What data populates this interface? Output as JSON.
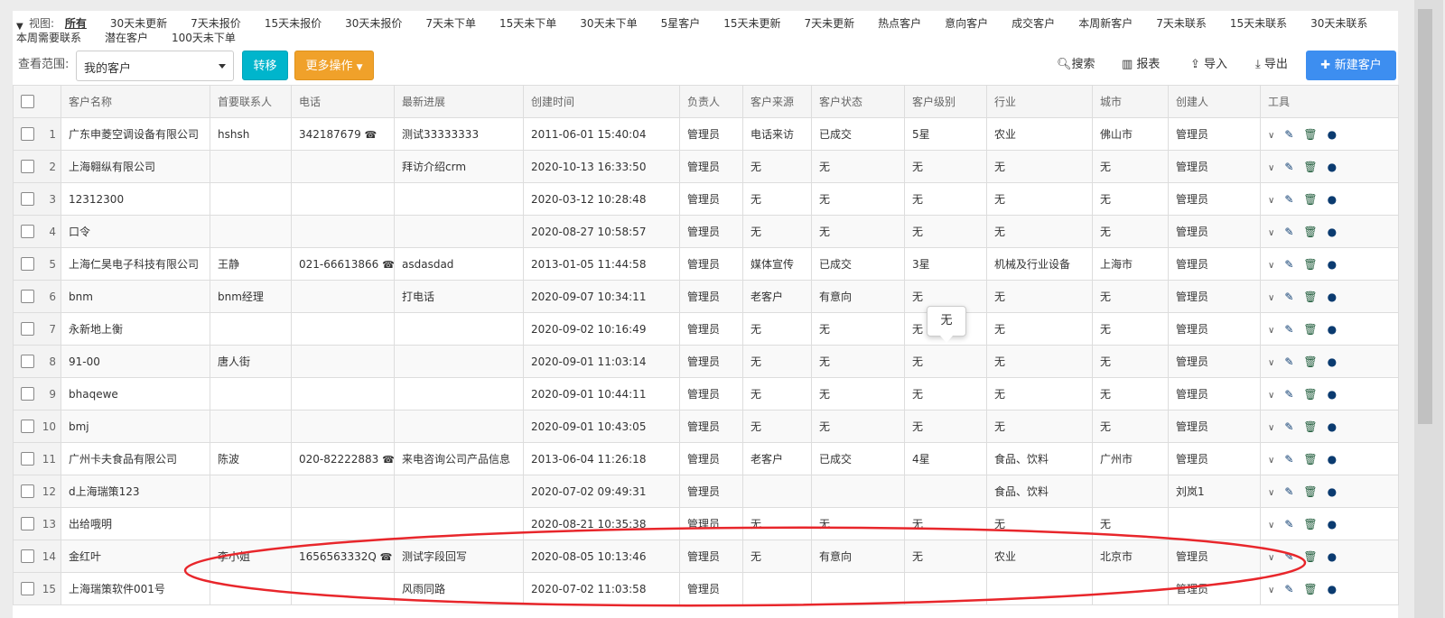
{
  "views": {
    "label": "视图:",
    "items": [
      "所有",
      "30天未更新",
      "7天未报价",
      "15天未报价",
      "30天未报价",
      "7天未下单",
      "15天未下单",
      "30天未下单",
      "5星客户",
      "15天未更新",
      "7天未更新",
      "热点客户",
      "意向客户",
      "成交客户",
      "本周新客户",
      "7天未联系",
      "15天未联系",
      "30天未联系",
      "本周需要联系",
      "潜在客户",
      "100天未下单"
    ]
  },
  "toolbar": {
    "scope_label": "查看范围:",
    "scope_value": "我的客户",
    "move": "转移",
    "more": "更多操作",
    "search": "搜索",
    "report": "报表",
    "import": "导入",
    "export": "导出",
    "new": "新建客户"
  },
  "columns": [
    "客户名称",
    "首要联系人",
    "电话",
    "最新进展",
    "创建时间",
    "负责人",
    "客户来源",
    "客户状态",
    "客户级别",
    "行业",
    "城市",
    "创建人",
    "工具"
  ],
  "rows": [
    [
      "广东申菱空调设备有限公司",
      "hshsh",
      "342187679",
      "测试33333333",
      "2011-06-01 15:40:04",
      "管理员",
      "电话来访",
      "已成交",
      "5星",
      "农业",
      "佛山市",
      "管理员"
    ],
    [
      "上海翱纵有限公司",
      "",
      "",
      "拜访介绍crm",
      "2020-10-13 16:33:50",
      "管理员",
      "无",
      "无",
      "无",
      "无",
      "无",
      "管理员"
    ],
    [
      "12312300",
      "",
      "",
      "",
      "2020-03-12 10:28:48",
      "管理员",
      "无",
      "无",
      "无",
      "无",
      "无",
      "管理员"
    ],
    [
      "口令",
      "",
      "",
      "",
      "2020-08-27 10:58:57",
      "管理员",
      "无",
      "无",
      "无",
      "无",
      "无",
      "管理员"
    ],
    [
      "上海仁昊电子科技有限公司",
      "王静",
      "021-66613866",
      "asdasdad",
      "2013-01-05 11:44:58",
      "管理员",
      "媒体宣传",
      "已成交",
      "3星",
      "机械及行业设备",
      "上海市",
      "管理员"
    ],
    [
      "bnm",
      "bnm经理",
      "",
      "打电话",
      "2020-09-07 10:34:11",
      "管理员",
      "老客户",
      "有意向",
      "无",
      "无",
      "无",
      "管理员"
    ],
    [
      "永新地上衡",
      "",
      "",
      "",
      "2020-09-02 10:16:49",
      "管理员",
      "无",
      "无",
      "无",
      "无",
      "无",
      "管理员"
    ],
    [
      "91-00",
      "唐人街",
      "",
      "",
      "2020-09-01 11:03:14",
      "管理员",
      "无",
      "无",
      "无",
      "无",
      "无",
      "管理员"
    ],
    [
      "bhaqewe",
      "",
      "",
      "",
      "2020-09-01 10:44:11",
      "管理员",
      "无",
      "无",
      "无",
      "无",
      "无",
      "管理员"
    ],
    [
      "bmj",
      "",
      "",
      "",
      "2020-09-01 10:43:05",
      "管理员",
      "无",
      "无",
      "无",
      "无",
      "无",
      "管理员"
    ],
    [
      "广州卡夫食品有限公司",
      "陈波",
      "020-82222883",
      "来电咨询公司产品信息",
      "2013-06-04 11:26:18",
      "管理员",
      "老客户",
      "已成交",
      "4星",
      "食品、饮料",
      "广州市",
      "管理员"
    ],
    [
      "d上海瑞策123",
      "",
      "",
      "",
      "2020-07-02 09:49:31",
      "管理员",
      "",
      "",
      "",
      "食品、饮料",
      "",
      "刘岚1"
    ],
    [
      "出给哦明",
      "",
      "",
      "",
      "2020-08-21 10:35:38",
      "管理员",
      "无",
      "无",
      "无",
      "无",
      "无",
      ""
    ],
    [
      "金红叶",
      "李小姐",
      "1656563332Q",
      "测试字段回写",
      "2020-08-05 10:13:46",
      "管理员",
      "无",
      "有意向",
      "无",
      "农业",
      "北京市",
      "管理员"
    ],
    [
      "上海瑞策软件001号",
      "",
      "",
      "风雨同路",
      "2020-07-02 11:03:58",
      "管理员",
      "",
      "",
      "",
      "",
      "",
      "管理员"
    ]
  ],
  "tooltip": "无",
  "colors": {
    "move": "#00b5cc",
    "more": "#f0a12a",
    "new": "#3d8ef0",
    "annotation": "#e8262b"
  }
}
